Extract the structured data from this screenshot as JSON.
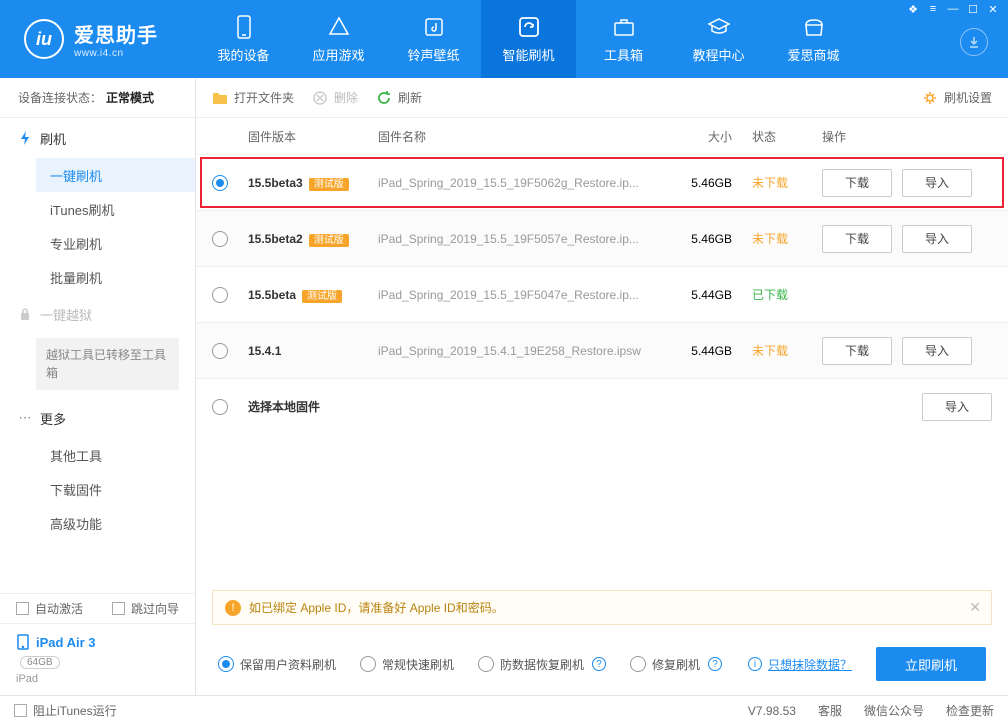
{
  "brand": {
    "name": "爱思助手",
    "domain": "www.i4.cn",
    "logo_letter": "iu"
  },
  "nav": {
    "items": [
      {
        "label": "我的设备"
      },
      {
        "label": "应用游戏"
      },
      {
        "label": "铃声壁纸"
      },
      {
        "label": "智能刷机"
      },
      {
        "label": "工具箱"
      },
      {
        "label": "教程中心"
      },
      {
        "label": "爱思商城"
      }
    ],
    "active_index": 3
  },
  "sidebar": {
    "connection_label": "设备连接状态：",
    "connection_value": "正常模式",
    "groups": {
      "flash": {
        "title": "刷机",
        "items": [
          "一键刷机",
          "iTunes刷机",
          "专业刷机",
          "批量刷机"
        ],
        "active_index": 0
      },
      "jailbreak": {
        "title": "一键越狱",
        "box": "越狱工具已转移至工具箱"
      },
      "more": {
        "title": "更多",
        "items": [
          "其他工具",
          "下载固件",
          "高级功能"
        ]
      }
    },
    "auto_activate": "自动激活",
    "skip_guide": "跳过向导",
    "device": {
      "name": "iPad Air 3",
      "capacity": "64GB",
      "type": "iPad"
    }
  },
  "toolbar": {
    "open": "打开文件夹",
    "delete": "删除",
    "refresh": "刷新",
    "settings": "刷机设置"
  },
  "table": {
    "headers": {
      "version": "固件版本",
      "name": "固件名称",
      "size": "大小",
      "status": "状态",
      "op": "操作"
    },
    "rows": [
      {
        "version": "15.5beta3",
        "beta": true,
        "name": "iPad_Spring_2019_15.5_19F5062g_Restore.ip...",
        "size": "5.46GB",
        "status": "未下载",
        "status_cls": "nd",
        "highlighted": true,
        "selected": true,
        "download": true
      },
      {
        "version": "15.5beta2",
        "beta": true,
        "name": "iPad_Spring_2019_15.5_19F5057e_Restore.ip...",
        "size": "5.46GB",
        "status": "未下载",
        "status_cls": "nd",
        "download": true
      },
      {
        "version": "15.5beta",
        "beta": true,
        "name": "iPad_Spring_2019_15.5_19F5047e_Restore.ip...",
        "size": "5.44GB",
        "status": "已下载",
        "status_cls": "dl",
        "download": false
      },
      {
        "version": "15.4.1",
        "beta": false,
        "name": "iPad_Spring_2019_15.4.1_19E258_Restore.ipsw",
        "size": "5.44GB",
        "status": "未下载",
        "status_cls": "nd",
        "download": true
      },
      {
        "version": "选择本地固件",
        "beta": false,
        "name": "",
        "size": "",
        "status": "",
        "local": true
      }
    ],
    "btn_download": "下载",
    "btn_import": "导入",
    "beta_tag": "测试版"
  },
  "notice": "如已绑定 Apple ID，请准备好 Apple ID和密码。",
  "flash_opts": {
    "keep": "保留用户资料刷机",
    "normal": "常规快速刷机",
    "anti": "防数据恢复刷机",
    "repair": "修复刷机",
    "erase_link": "只想抹除数据？",
    "go": "立即刷机"
  },
  "footer": {
    "block_itunes": "阻止iTunes运行",
    "version": "V7.98.53",
    "support": "客服",
    "wechat": "微信公众号",
    "update": "检查更新"
  }
}
